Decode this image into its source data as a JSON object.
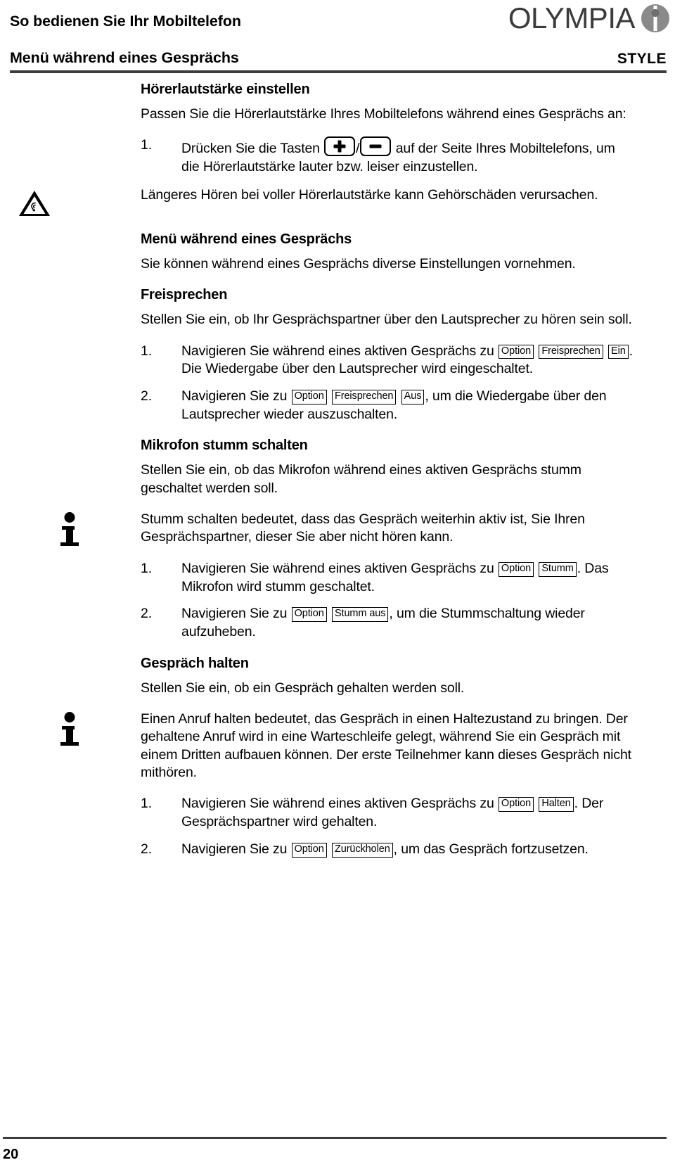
{
  "header": {
    "title": "So bedienen Sie Ihr Mobiltelefon",
    "subtitle": "Menü während eines Gesprächs",
    "model": "STYLE",
    "logo_word": "OLYMPIA"
  },
  "sections": {
    "volume": {
      "heading": "Hörerlautstärke einstellen",
      "intro": "Passen Sie die Hörerlautstärke Ihres Mobiltelefons während eines Gesprächs an:",
      "step1_num": "1.",
      "step1_a": "Drücken Sie die Tasten ",
      "step1_sep": "/",
      "step1_b": " auf der Seite Ihres Mobiltelefons, um die Hörerlautstärke lauter bzw. leiser einzustellen.",
      "key_plus": "plus-key",
      "key_minus": "minus-key",
      "warning": "Längeres Hören bei voller Hörerlautstärke kann Gehörschäden verursachen."
    },
    "menu": {
      "heading": "Menü während eines Gesprächs",
      "intro": "Sie können während eines Gesprächs diverse Einstellungen vornehmen."
    },
    "handsfree": {
      "heading": "Freisprechen",
      "intro": "Stellen Sie ein, ob Ihr Gesprächspartner über den Lautsprecher zu hören sein soll.",
      "step1_num": "1.",
      "step1_a": "Navigieren Sie während eines aktiven Gesprächs zu ",
      "step1_chip1": "Option",
      "step1_chip2": "Freisprechen",
      "step1_chip3": "Ein",
      "step1_b": ". Die Wiedergabe über den Lautsprecher wird eingeschaltet.",
      "step2_num": "2.",
      "step2_a": "Navigieren Sie zu ",
      "step2_chip1": "Option",
      "step2_chip2": "Freisprechen",
      "step2_chip3": "Aus",
      "step2_b": ", um die Wiedergabe über den Lautsprecher wieder auszuschalten."
    },
    "mute": {
      "heading": "Mikrofon stumm schalten",
      "intro": "Stellen Sie ein, ob das Mikrofon während eines aktiven Gesprächs stumm geschaltet werden soll.",
      "note": "Stumm schalten bedeutet, dass das Gespräch weiterhin aktiv ist, Sie Ihren Gesprächspartner, dieser Sie aber nicht hören kann.",
      "step1_num": "1.",
      "step1_a": "Navigieren Sie während eines aktiven Gesprächs zu ",
      "step1_chip1": "Option",
      "step1_chip2": "Stumm",
      "step1_b": ". Das Mikrofon wird stumm geschaltet.",
      "step2_num": "2.",
      "step2_a": "Navigieren Sie zu ",
      "step2_chip1": "Option",
      "step2_chip2": "Stumm aus",
      "step2_b": ", um die Stummschaltung wieder aufzuheben."
    },
    "hold": {
      "heading": "Gespräch halten",
      "intro": "Stellen Sie ein, ob ein Gespräch gehalten werden soll.",
      "note": "Einen Anruf halten bedeutet, das Gespräch in einen Haltezustand zu bringen. Der gehaltene Anruf wird in eine Warteschleife gelegt, während Sie ein Gespräch mit einem Dritten aufbauen können. Der erste Teilnehmer kann dieses Gespräch nicht mithören.",
      "step1_num": "1.",
      "step1_a": "Navigieren Sie während eines aktiven Gesprächs zu ",
      "step1_chip1": "Option",
      "step1_chip2": "Halten",
      "step1_b": ". Der Gesprächspartner wird gehalten.",
      "step2_num": "2.",
      "step2_a": "Navigieren Sie zu ",
      "step2_chip1": "Option",
      "step2_chip2": "Zurückholen",
      "step2_b": ", um das Gespräch fortzusetzen."
    }
  },
  "footer": {
    "page_number": "20"
  },
  "icons": {
    "warning_hearing": "hearing-warning-icon",
    "info": "info-icon"
  }
}
